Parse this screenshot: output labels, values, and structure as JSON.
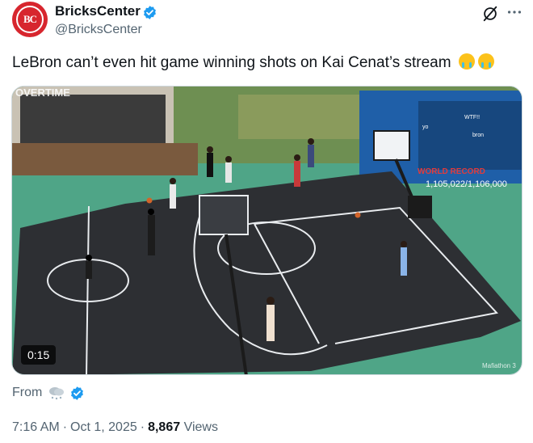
{
  "account": {
    "avatar_text": "BC",
    "display_name": "BricksCenter",
    "handle": "@BricksCenter"
  },
  "tweet": {
    "text": "LeBron can’t even hit game winning shots on Kai Cenat’s stream",
    "emojis": [
      "loudly-crying-face-emoji",
      "loudly-crying-face-emoji"
    ]
  },
  "video": {
    "duration": "0:15",
    "overlay": {
      "corner_text": "OVERTIME",
      "record_label": "WORLD RECORD",
      "sub_counter": "1,105,022/1,106,000",
      "chat_lines": [
        "WTF!!",
        "yo",
        "bron"
      ],
      "watermark": "Mafiathon 3"
    }
  },
  "source": {
    "from_label": "From"
  },
  "meta": {
    "time": "7:16 AM",
    "date": "Oct 1, 2025",
    "views_count": "8,867",
    "views_label": "Views",
    "separator": "·"
  },
  "colors": {
    "brand_red": "#d7262e",
    "verified_blue": "#1d9bf0",
    "text_primary": "#0f1419",
    "text_secondary": "#536471",
    "court_surface": "#2d2f33",
    "court_surround": "#4fa587"
  }
}
